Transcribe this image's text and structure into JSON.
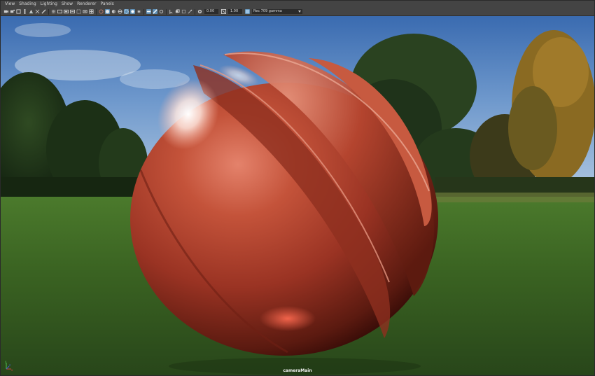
{
  "menu": {
    "items": [
      "View",
      "Shading",
      "Lighting",
      "Show",
      "Renderer",
      "Panels"
    ]
  },
  "toolbar": {
    "exposure_value": "0.00",
    "gamma_value": "1.00",
    "color_space": "Rec 709 gamma",
    "icons": [
      "select-camera-icon",
      "camera-attributes-icon",
      "bookmark-icon",
      "image-plane-icon",
      "grid-icon",
      "film-gate-icon",
      "resolution-gate-icon",
      "gate-mask-icon",
      "field-chart-icon",
      "safe-action-icon",
      "safe-title-icon",
      "wireframe-icon",
      "smooth-shade-icon",
      "default-material-icon",
      "textured-icon",
      "use-all-lights-icon",
      "shadows-icon",
      "ambient-occlusion-icon",
      "motion-blur-icon",
      "anti-aliasing-icon",
      "depth-of-field-icon",
      "isolate-select-icon",
      "xray-icon",
      "xray-joints-icon",
      "xray-active-icon",
      "exposure-icon",
      "gamma-icon",
      "color-management-icon"
    ]
  },
  "viewport": {
    "camera_name": "cameraMain",
    "axis_labels": {
      "x": "x",
      "y": "y",
      "z": "z"
    },
    "colors": {
      "sky_top": "#3d6fb0",
      "sky_horizon": "#a9c3de",
      "grass_far": "#3f6a26",
      "grass_near": "#2c4f1a",
      "sphere_base": "#b8442c",
      "sphere_dark": "#4a130c"
    }
  }
}
